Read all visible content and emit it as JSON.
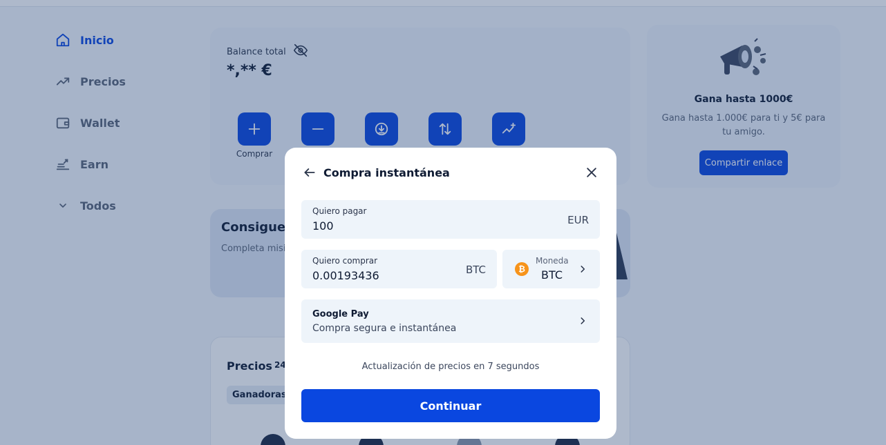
{
  "sidebar": {
    "items": [
      {
        "label": "Inicio",
        "icon": "home-icon",
        "active": true
      },
      {
        "label": "Precios",
        "icon": "trending-up-icon"
      },
      {
        "label": "Wallet",
        "icon": "wallet-icon"
      },
      {
        "label": "Earn",
        "icon": "stacked-coins-icon"
      },
      {
        "label": "Todos",
        "icon": "chevron-down-icon"
      }
    ]
  },
  "balance": {
    "label": "Balance total",
    "value": "*,** €",
    "actions": [
      {
        "label": "Comprar",
        "icon": "plus-icon"
      },
      {
        "label": "",
        "icon": "minus-icon"
      },
      {
        "label": "",
        "icon": "deposit-icon"
      },
      {
        "label": "",
        "icon": "swap-icon"
      },
      {
        "label": "",
        "icon": "chart-plus-icon"
      }
    ]
  },
  "promo": {
    "title": "Gana hasta 1000€",
    "description": "Gana hasta 1.000€ para ti y 5€ para tu amigo.",
    "button_label": "Compartir enlace"
  },
  "mission": {
    "title": "Consigue",
    "description": "Completa misi"
  },
  "prices": {
    "title": "Precios",
    "badge": "24",
    "tab": "Ganadoras"
  },
  "modal": {
    "title": "Compra instantánea",
    "pay": {
      "label": "Quiero pagar",
      "value": "100",
      "currency": "EUR"
    },
    "buy": {
      "label": "Quiero comprar",
      "value": "0.00193436",
      "currency": "BTC"
    },
    "coin": {
      "label": "Moneda",
      "value": "BTC",
      "icon": "bitcoin-icon",
      "color": "#f7931a"
    },
    "method": {
      "title": "Google Pay",
      "description": "Compra segura e instantánea"
    },
    "refresh_note": "Actualización de precios en 7 segundos",
    "continue_label": "Continuar"
  },
  "colors": {
    "primary": "#0a47e0",
    "overlay": "rgba(30,60,110,0.36)",
    "field_bg": "#eef4fa"
  }
}
